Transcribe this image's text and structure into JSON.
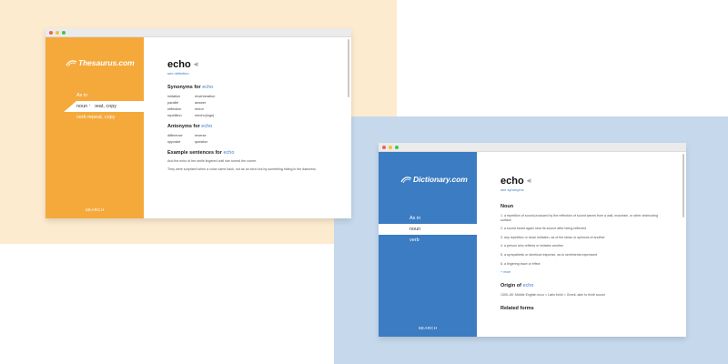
{
  "colors": {
    "thesaurus_accent": "#f5a93b",
    "dictionary_accent": "#3b7cc2",
    "link_blue": "#3a7bc8",
    "bg_orange": "#fdebd0",
    "bg_blue": "#c6d9ec"
  },
  "thesaurus": {
    "logo_text": "Thesaurus.com",
    "nav": [
      "As in",
      "noun repeat, copy",
      "verb repeat, copy"
    ],
    "search_label": "SEARCH",
    "headword": "echo",
    "see_link": "see definition",
    "synonyms_prefix": "Synonyms for",
    "synonyms_word": "echo",
    "synonyms": [
      [
        "imitation",
        "reverberation"
      ],
      [
        "parallel",
        "answer"
      ],
      [
        "reflection",
        "mirror"
      ],
      [
        "repetition",
        "reecho(ings)"
      ]
    ],
    "antonyms_prefix": "Antonyms for",
    "antonyms_word": "echo",
    "antonyms": [
      [
        "difference",
        "reverse"
      ],
      [
        "opposite",
        "question"
      ]
    ],
    "examples_prefix": "Example sentences for",
    "examples_word": "echo",
    "examples": [
      "And the echo of her smile lingered until she turned the corner.",
      "They were surprised when a voice came back, not as an echo but by something hiding in the darkness."
    ]
  },
  "dictionary": {
    "logo_text": "Dictionary.com",
    "nav": [
      "As in",
      "noun",
      "verb"
    ],
    "search_label": "SEARCH",
    "headword": "echo",
    "see_link": "see synonyms",
    "noun_title": "Noun",
    "definitions": [
      "1. a repetition of sound produced by the reflection of sound waves from a wall, mountain, or other obstructing surface",
      "2. a sound heard again near its source after being reflected",
      "3. any repetition or close imitation, as of the ideas or opinions of another",
      "4. a person who reflects or imitates another",
      "5. a sympathetic or identical response, as to sentiments expressed",
      "6. a lingering trace or effect"
    ],
    "more_link": "+ more",
    "origin_prefix": "Origin of",
    "origin_word": "echo",
    "origin_text": "1300–50; Middle English ecco < Latin ēchō < Greek, akin to ēchē sound",
    "related_title": "Related forms"
  }
}
